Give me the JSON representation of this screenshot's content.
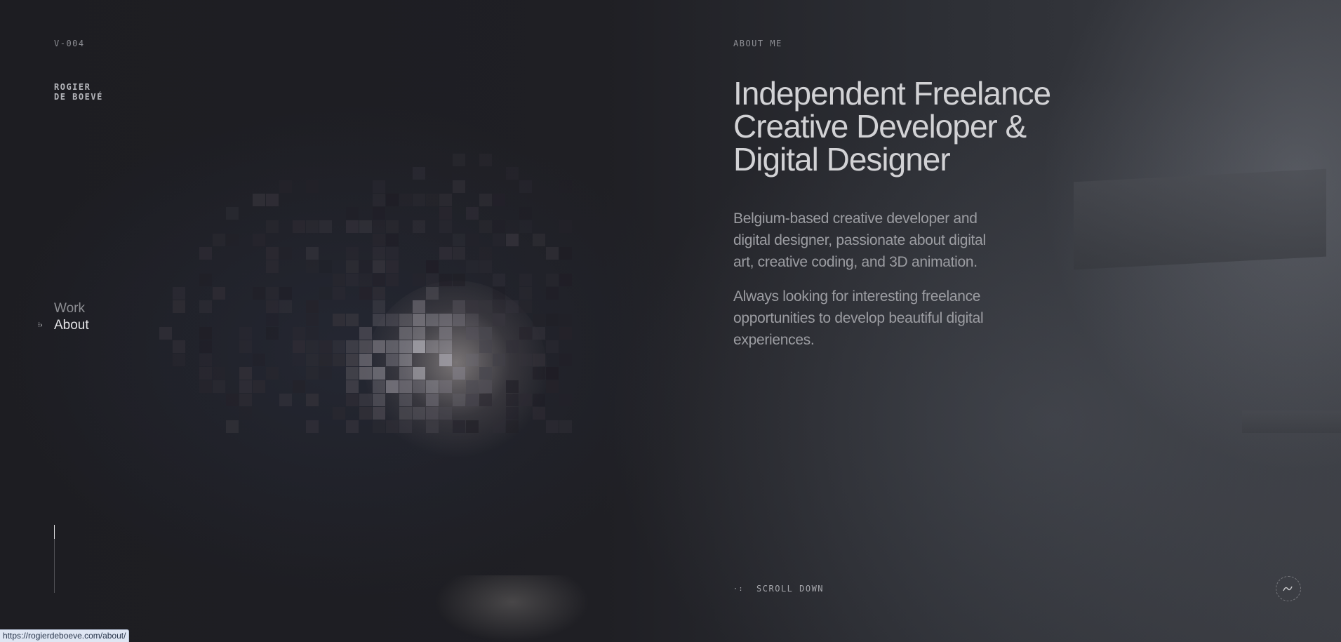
{
  "header": {
    "version": "V-004",
    "logo_line1": "ROGIER",
    "logo_line2": "DE BOEVÉ",
    "section_label": "ABOUT ME"
  },
  "nav": {
    "items": [
      {
        "label": "Work",
        "active": false
      },
      {
        "label": "About",
        "active": true
      }
    ]
  },
  "main": {
    "headline": [
      "Independent Freelance",
      "Creative Developer &",
      "Digital Designer"
    ],
    "paragraph1": [
      "Belgium-based creative developer and",
      "digital designer, passionate about digital",
      "art, creative coding, and 3D animation."
    ],
    "paragraph2": [
      "Always looking for interesting freelance",
      "opportunities to develop beautiful digital",
      "experiences."
    ]
  },
  "footer": {
    "scroll_label": "SCROLL DOWN",
    "sound_icon": "sound-wave-icon"
  },
  "status_bar": {
    "url": "https://rogierdeboeve.com/about/"
  },
  "colors": {
    "background": "#1c1c20",
    "text_primary": "#d2d2d5",
    "text_secondary": "#9c9da2",
    "accent_active": "#e4e4e7"
  }
}
